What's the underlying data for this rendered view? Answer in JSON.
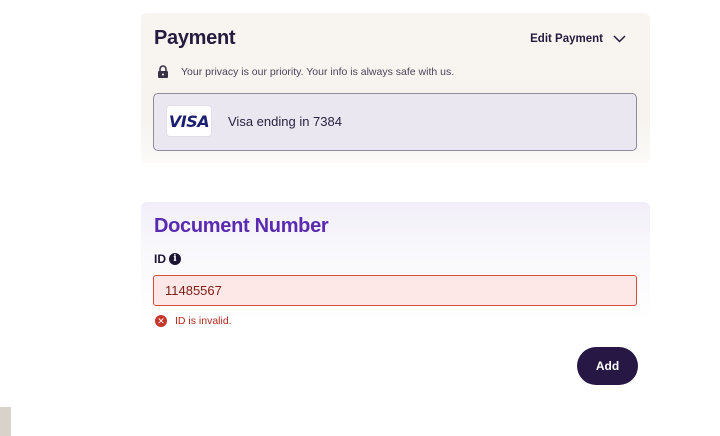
{
  "payment": {
    "title": "Payment",
    "edit_label": "Edit Payment",
    "privacy_text": "Your privacy is our priority. Your info is always safe with us.",
    "card_brand": "VISA",
    "card_text": "Visa ending in 7384"
  },
  "document": {
    "title": "Document Number",
    "id_label": "ID",
    "id_value": "11485567",
    "error_text": "ID is invalid.",
    "add_label": "Add"
  },
  "icons": {
    "edit_chevron": "chevron-down-icon",
    "privacy": "lock-icon",
    "id_info": "info-icon",
    "error": "error-x-icon"
  },
  "colors": {
    "primary_dark": "#261744",
    "heading_purple": "#5a2bb0",
    "error_red": "#b3261e",
    "error_bg": "#fde7e7",
    "visa_blue": "#1a1f71"
  }
}
